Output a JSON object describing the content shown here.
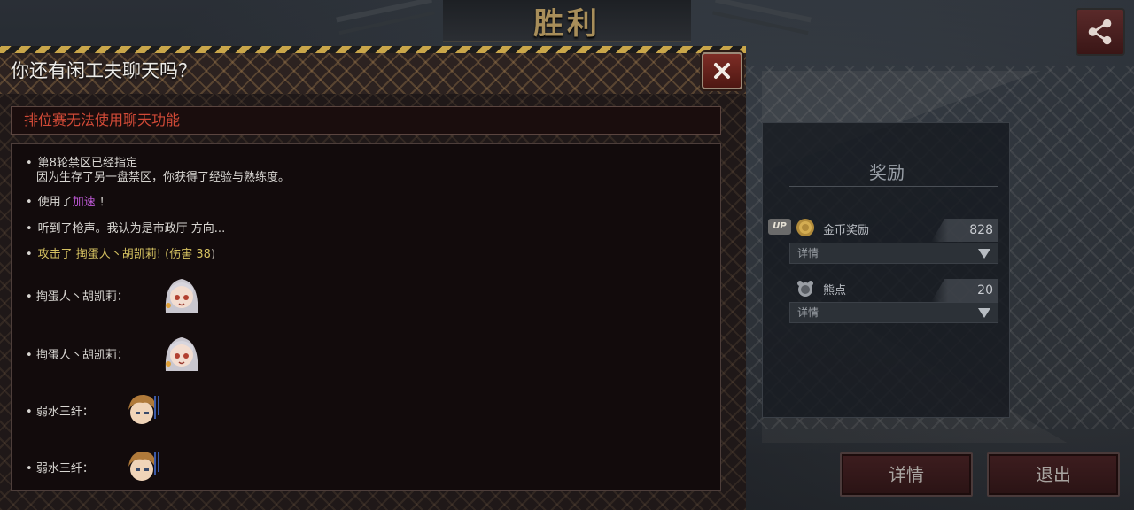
{
  "header": {
    "victory_title": "胜利"
  },
  "dialog": {
    "title": "你还有闲工夫聊天吗？",
    "notice": "排位赛无法使用聊天功能",
    "messages": {
      "m1_line1": "第8轮禁区已经指定",
      "m1_line2": "因为生存了另一盘禁区，你获得了经验与熟练度。",
      "m2_prefix": "使用了",
      "m2_skill": "加速",
      "m2_suffix": "！",
      "m3": "听到了枪声。我认为是市政厅 方向...",
      "m4_prefix": "攻击了 掏蛋人丶胡凯莉! (伤害 ",
      "m4_damage": "38",
      "m4_suffix": ")",
      "s1_name": "掏蛋人丶胡凯莉：",
      "s2_name": "掏蛋人丶胡凯莉：",
      "s3_name": "弱水三纤：",
      "s4_name": "弱水三纤："
    }
  },
  "reward": {
    "title": "奖励",
    "coin_label": "金币奖励",
    "coin_value": "828",
    "coin_detail": "详情",
    "bear_label": "熊点",
    "bear_value": "20",
    "bear_detail": "详情",
    "up_badge": "UP"
  },
  "buttons": {
    "detail": "详情",
    "exit": "退出"
  },
  "icons": {
    "share": "share-icon",
    "close": "close-icon",
    "coin": "coin-icon",
    "bear": "bear-point-icon"
  },
  "colors": {
    "notice_red": "#d24a37",
    "skill_purple": "#c05ad8",
    "attack_yellow": "#d4c060",
    "victory_gold": "#a88e5a"
  }
}
